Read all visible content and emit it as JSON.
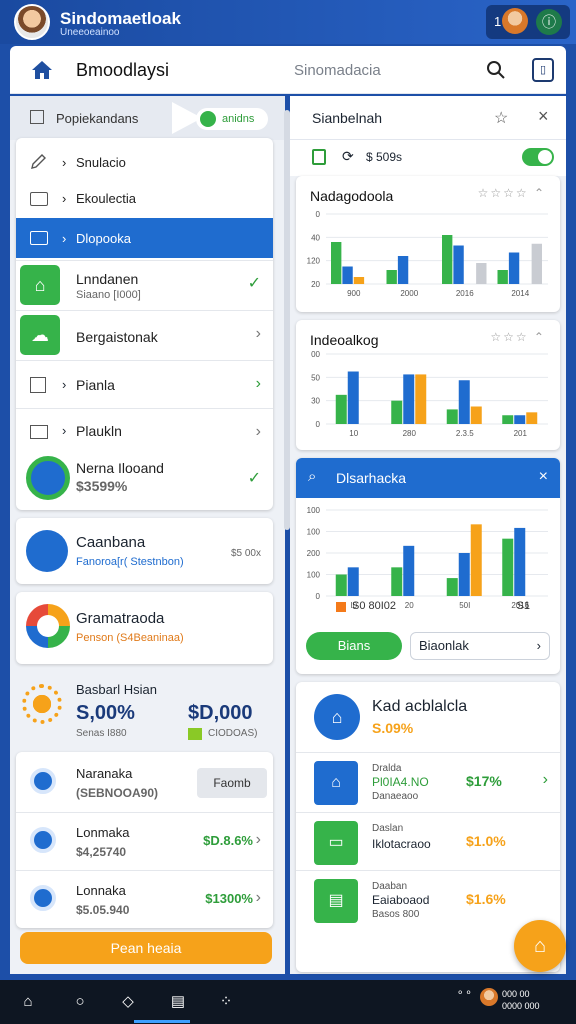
{
  "topbar": {
    "title": "Sindomaetloak",
    "subtitle": "Uneeoeainoo",
    "notif_count": "1",
    "badge": "ⓘ"
  },
  "header": {
    "title": "Bmoodlaysi",
    "center": "Sinomadacia"
  },
  "left": {
    "head_title": "Popiekandans",
    "head_pill": "anidns",
    "nav": [
      {
        "label": "Snulacio",
        "icon": "edit-icon"
      },
      {
        "label": "Ekoulectia",
        "icon": "folder-icon"
      },
      {
        "label": "Dlopooka",
        "icon": "folder-icon"
      }
    ],
    "rows": [
      {
        "label": "Lnndanen",
        "sub": "Siaano [I000]",
        "end": "✓"
      },
      {
        "label": "Bergaistonak",
        "sub": "",
        "end": "›"
      },
      {
        "label": "Pianla",
        "sub": "",
        "end": "›"
      },
      {
        "label": "Plaukln",
        "sub": "",
        "end": "›"
      },
      {
        "label": "Nerna Ilooand",
        "sub": "$3599%",
        "end": "✓"
      }
    ],
    "cards": [
      {
        "title": "Caanbana",
        "sub": "Fanoroa[r( Stestnbon)",
        "val": "$5 00x"
      },
      {
        "title": "Gramatraoda",
        "sub": "Penson (S4Beaninaa)",
        "val": ""
      }
    ],
    "summary": {
      "title": "Basbarl Hsian",
      "pct": "S,00%",
      "pct_sub": "Senas I880",
      "amount": "$D,000",
      "amount_sub": "CIODOAS)"
    },
    "list": [
      {
        "name": "Naranaka",
        "sub": "(SEBNOOA90)",
        "btn": "Faomb"
      },
      {
        "name": "Lonmaka",
        "sub": "$4,25740",
        "val": "$D.8.6%"
      },
      {
        "name": "Lonnaka",
        "sub": "$5.05.940",
        "val": "$1300%"
      }
    ],
    "cta": "Pean heaia"
  },
  "right": {
    "head_title": "Sianbelnah",
    "head_val": "$ 509s",
    "chart1_title": "Nadagodoola",
    "chart2_title": "Indeoalkog",
    "chart3_title": "Dlsarhacka",
    "chart3_legend": "S0 80I02",
    "chart3_note": "S1",
    "pill_btn": "Bians",
    "input_value": "Biaonlak",
    "detail": {
      "title": "Kad acblalcla",
      "pct": "S.09%",
      "items": [
        {
          "title": "Dralda",
          "name": "Pl0IA4.NO",
          "sub": "Danaeaoo",
          "val": "$17%"
        },
        {
          "title": "Daslan",
          "name": "Iklotacraoo",
          "sub": "",
          "val": "$1.0%"
        },
        {
          "title": "Daaban",
          "name": "Eaiaboaod",
          "sub": "Basos 800",
          "val": "$1.6%"
        }
      ]
    }
  },
  "colors": {
    "green": "#36b34a",
    "blue": "#1f6ccf",
    "orange": "#f6a21a",
    "grey": "#c9ccd2"
  },
  "chart_data": [
    {
      "type": "bar",
      "title": "Nadagodoola",
      "categories": [
        "900",
        "2000",
        "2016",
        "2014"
      ],
      "ylim": [
        0,
        200
      ],
      "ticks_y": [
        "0",
        "40",
        "120",
        "20"
      ],
      "series": [
        {
          "values": [
            120,
            40,
            140,
            40
          ]
        },
        {
          "values": [
            50,
            80,
            110,
            90
          ]
        },
        {
          "values": [
            20,
            0,
            0,
            0
          ]
        },
        {
          "values": [
            0,
            0,
            60,
            115
          ]
        }
      ]
    },
    {
      "type": "bar",
      "title": "Indeoalkog",
      "categories": [
        "10",
        "280",
        "2.3.5",
        "201"
      ],
      "ticks_y": [
        "00",
        "50",
        "30",
        "0"
      ],
      "series": [
        {
          "values": [
            50,
            40,
            25,
            15
          ]
        },
        {
          "values": [
            90,
            85,
            75,
            15
          ]
        },
        {
          "values": [
            0,
            85,
            30,
            20
          ]
        }
      ]
    },
    {
      "type": "bar",
      "title": "Dlsarhacka",
      "categories": [
        "I0",
        "20",
        "50I",
        "2016"
      ],
      "ticks_y": [
        "100",
        "100",
        "200",
        "100",
        "0"
      ],
      "series": [
        {
          "values": [
            30,
            40,
            25,
            80
          ]
        },
        {
          "values": [
            40,
            70,
            60,
            95
          ]
        },
        {
          "values": [
            0,
            0,
            100,
            0
          ]
        }
      ]
    }
  ]
}
